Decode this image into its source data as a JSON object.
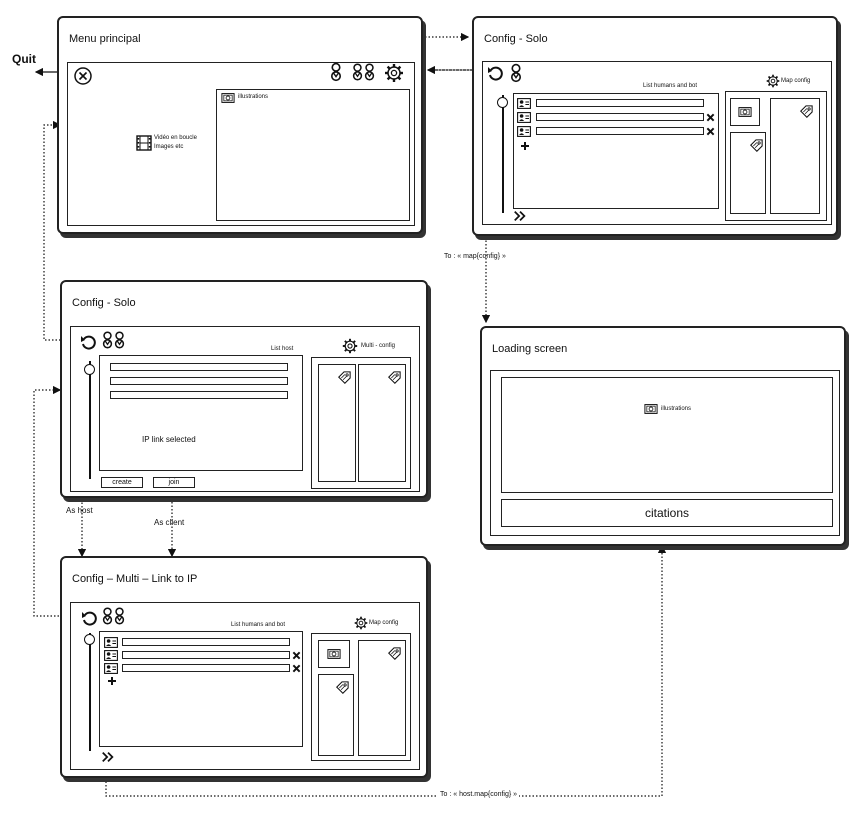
{
  "quit": "Quit",
  "menu": {
    "title": "Menu principal",
    "video_line1": "Vidéo en boucle",
    "video_line2": "Images etc",
    "illustrations": "illustrations"
  },
  "solo_top": {
    "title": "Config - Solo",
    "list_label": "List humans and bot",
    "map_config": "Map config"
  },
  "to_map_config": "To : « map{config} »",
  "solo_mid": {
    "title": "Config - Solo",
    "list_label": "List host",
    "multi_config": "Multi - config",
    "ip_link": "IP link selected",
    "create": "create",
    "join": "join"
  },
  "loading": {
    "title": "Loading screen",
    "illustrations": "illustrations",
    "citations": "citations"
  },
  "as_host": "As host",
  "as_client": "As client",
  "multi": {
    "title": "Config – Multi – Link to IP",
    "list_label": "List humans and bot",
    "map_config": "Map config"
  },
  "to_host_map_config": "To : « host.map{config} »"
}
